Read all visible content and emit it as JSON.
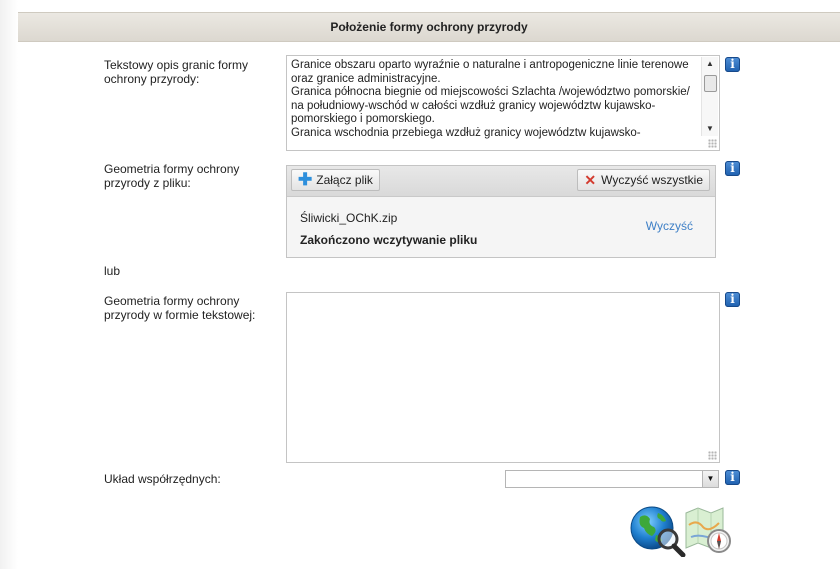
{
  "section": {
    "title": "Położenie formy ochrony przyrody"
  },
  "boundary_description": {
    "label": "Tekstowy opis granic formy ochrony przyrody:",
    "value": "Granice obszaru oparto wyraźnie o naturalne i antropogeniczne linie terenowe oraz granice administracyjne.\nGranica północna biegnie od miejscowości Szlachta /województwo pomorskie/ na południowy-wschód w całości wzdłuż granicy województw kujawsko-pomorskiego i pomorskiego.\nGranica wschodnia przebiega wzdłuż granicy województw kujawsko-"
  },
  "geometry_file": {
    "label": "Geometria formy ochrony przyrody z pliku:",
    "attach_label": "Załącz plik",
    "clear_all_label": "Wyczyść wszystkie",
    "file_name": "Śliwicki_OChK.zip",
    "status": "Zakończono wczytywanie pliku",
    "clear_label": "Wyczyść"
  },
  "or_text": "lub",
  "geometry_text": {
    "label": "Geometria formy ochrony przyrody w formie tekstowej:",
    "value": ""
  },
  "coordinate_system": {
    "label": "Układ współrzędnych:",
    "selected": ""
  },
  "info_glyph": "i",
  "icons": {
    "info": "info-icon",
    "globe_search": "globe-search-icon",
    "map_compass": "map-compass-icon"
  }
}
